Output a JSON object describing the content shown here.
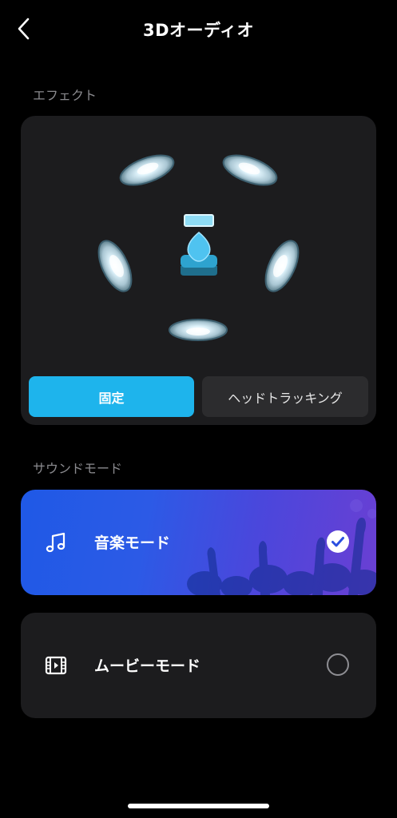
{
  "header": {
    "title": "3Dオーディオ"
  },
  "effect_section": {
    "label": "エフェクト",
    "buttons": [
      {
        "label": "固定",
        "selected": true
      },
      {
        "label": "ヘッドトラッキング",
        "selected": false
      }
    ]
  },
  "sound_mode_section": {
    "label": "サウンドモード",
    "modes": [
      {
        "label": "音楽モード",
        "icon": "music-note-icon",
        "selected": true
      },
      {
        "label": "ムービーモード",
        "icon": "film-icon",
        "selected": false
      }
    ]
  },
  "colors": {
    "accent": "#1eb4ec",
    "card": "#1c1c1e",
    "background": "#000000"
  }
}
